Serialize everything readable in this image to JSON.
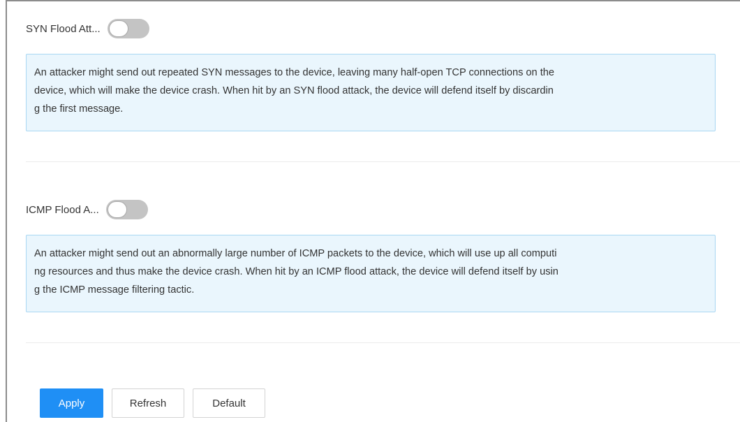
{
  "syn_flood": {
    "label": "SYN Flood Att...",
    "enabled": false,
    "description_lines": [
      "An attacker might send out repeated SYN messages to the device, leaving many half-open TCP connections on the",
      "device, which will make the device crash. When hit by an SYN flood attack, the device will defend itself by discardin",
      "g the first message."
    ]
  },
  "icmp_flood": {
    "label": "ICMP Flood A...",
    "enabled": false,
    "description_lines": [
      "An attacker might send out an abnormally large number of ICMP packets to the device, which will use up all computi",
      "ng resources and thus make the device crash. When hit by an ICMP flood attack, the device will defend itself by usin",
      "g the ICMP message filtering tactic."
    ]
  },
  "buttons": {
    "apply": "Apply",
    "refresh": "Refresh",
    "default": "Default"
  },
  "colors": {
    "primary": "#1f8ff5",
    "info_background": "#eaf6fd",
    "info_border": "#a9d7f3",
    "toggle_off": "#c4c4c4"
  }
}
